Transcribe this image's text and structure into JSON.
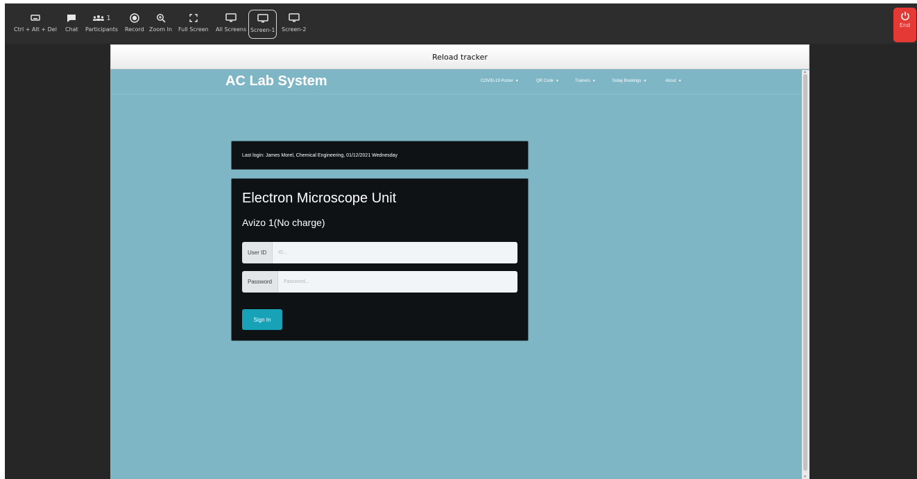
{
  "toolbar": {
    "items": [
      {
        "label": "Ctrl + Alt + Del",
        "icon": "keyboard-icon"
      },
      {
        "label": "Chat",
        "icon": "chat-icon"
      },
      {
        "label": "Participants",
        "icon": "participants-icon",
        "count": "1"
      },
      {
        "label": "Record",
        "icon": "record-icon"
      },
      {
        "label": "Zoom In",
        "icon": "zoom-in-icon"
      },
      {
        "label": "Full Screen",
        "icon": "fullscreen-icon"
      },
      {
        "label": "All Screens",
        "icon": "monitor-icon"
      },
      {
        "label": "Screen-1",
        "icon": "monitor-icon",
        "active": true
      },
      {
        "label": "Screen-2",
        "icon": "monitor-icon"
      }
    ],
    "end_label": "End"
  },
  "remote": {
    "reload_label": "Reload tracker",
    "brand": "AC Lab System",
    "nav": [
      "COVID-19 Poster",
      "QR Code",
      "Trainers",
      "Today Bookings",
      "About"
    ],
    "last_login": "Last login: James Morel, Chemical Engineering, 01/12/2021 Wednesday",
    "card": {
      "title": "Electron Microscope Unit",
      "instrument": "Avizo 1(No charge)",
      "user_id_label": "User ID",
      "user_id_placeholder": "ID...",
      "password_label": "Password",
      "password_placeholder": "Password...",
      "signin_label": "Sign In"
    }
  },
  "colors": {
    "page_background": "#7fb6c5",
    "card_background": "#0e1214",
    "signin_button": "#17a2b8",
    "end_button": "#e53935",
    "toolbar_background": "#2d2d2d"
  }
}
